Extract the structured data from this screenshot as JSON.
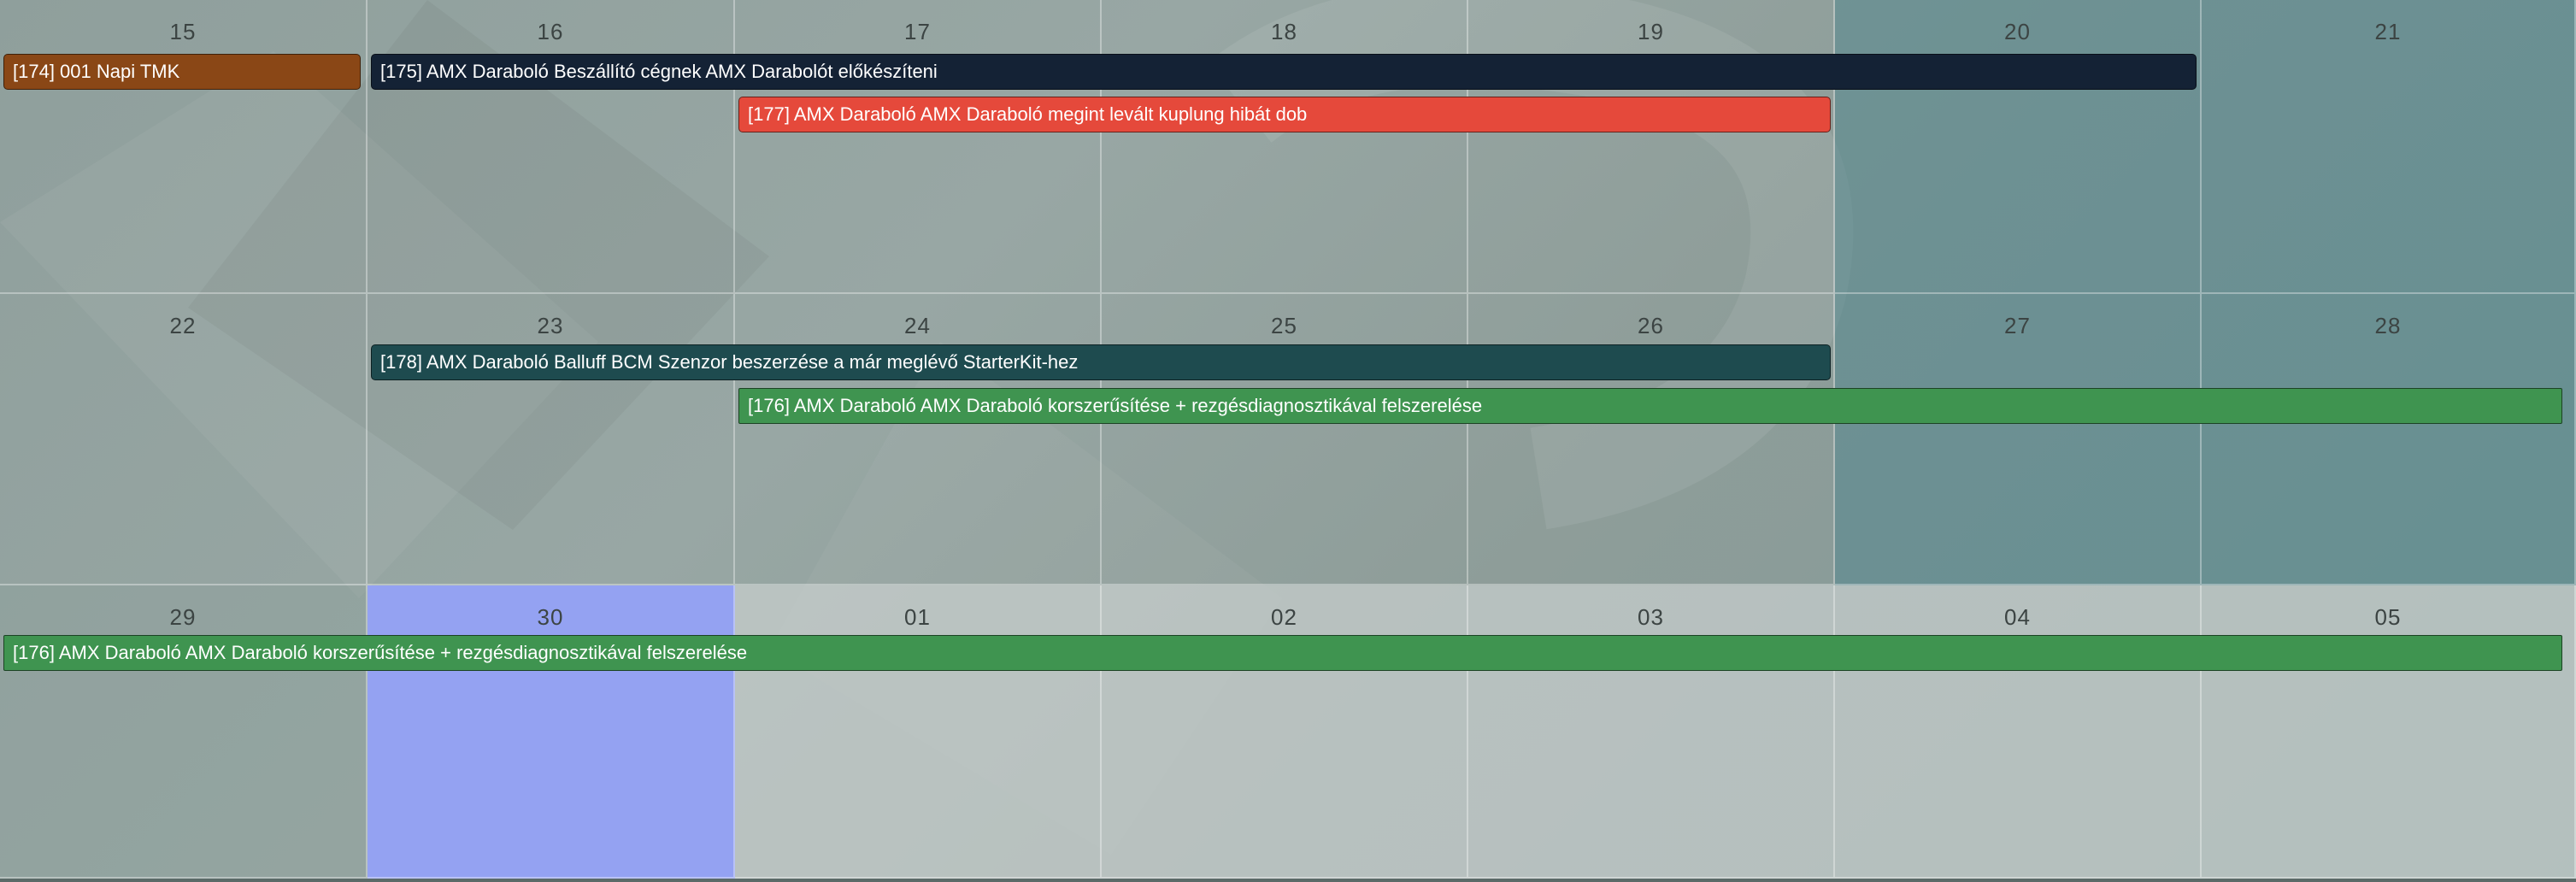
{
  "colors": {
    "orange": "#8a4716",
    "navy": "#142235",
    "red": "#e5493b",
    "teal": "#1e4b4f",
    "green": "#3f9450",
    "today": "#94a2f2"
  },
  "weeks": [
    {
      "days": [
        "15",
        "16",
        "17",
        "18",
        "19",
        "20",
        "21"
      ]
    },
    {
      "days": [
        "22",
        "23",
        "24",
        "25",
        "26",
        "27",
        "28"
      ]
    },
    {
      "days": [
        "29",
        "30",
        "01",
        "02",
        "03",
        "04",
        "05"
      ]
    }
  ],
  "events": [
    {
      "id": "174",
      "label": "[174] 001 Napi TMK",
      "color": "orange"
    },
    {
      "id": "175",
      "label": "[175] AMX Daraboló Beszállító cégnek AMX Darabolót előkészíteni",
      "color": "navy"
    },
    {
      "id": "177",
      "label": "[177] AMX Daraboló AMX Daraboló megint levált kuplung hibát dob",
      "color": "red"
    },
    {
      "id": "178",
      "label": "[178] AMX Daraboló Balluff BCM Szenzor beszerzése a már meglévő StarterKit-hez",
      "color": "teal"
    },
    {
      "id": "176a",
      "label": "[176] AMX Daraboló AMX Daraboló korszerűsítése + rezgésdiagnosztikával felszerelése",
      "color": "green"
    },
    {
      "id": "176b",
      "label": "[176] AMX Daraboló AMX Daraboló korszerűsítése + rezgésdiagnosztikával felszerelése",
      "color": "green"
    }
  ]
}
